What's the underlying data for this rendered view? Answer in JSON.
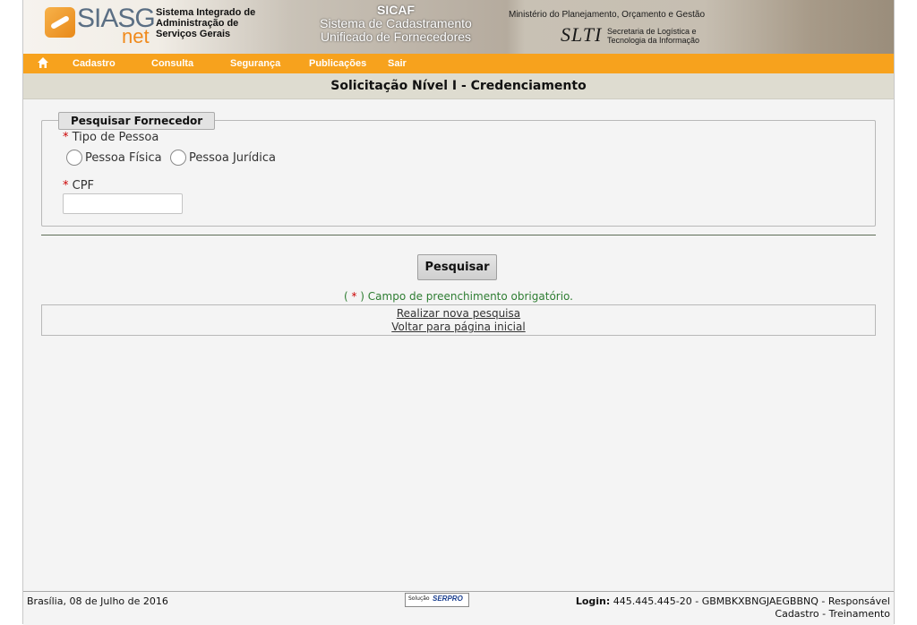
{
  "header": {
    "logo_text": "SIASG",
    "logo_sub": "net",
    "system_line1": "Sistema Integrado de",
    "system_line2": "Administração de",
    "system_line3": "Serviços Gerais",
    "sicaf_title": "SICAF",
    "sicaf_line1": "Sistema de Cadastramento",
    "sicaf_line2": "Unificado de Fornecedores",
    "ministerio": "Ministério do Planejamento, Orçamento e Gestão",
    "slti": "SLTI",
    "slti_line1": "Secretaria de Logística e",
    "slti_line2": "Tecnologia da Informação"
  },
  "menu": {
    "home_icon": "home-icon",
    "items": [
      "Cadastro",
      "Consulta",
      "Segurança",
      "Publicações",
      "Sair"
    ]
  },
  "page_title": "Solicitação Nível I - Credenciamento",
  "form": {
    "legend": "Pesquisar Fornecedor",
    "required_mark": "*",
    "tipo_label": "Tipo de Pessoa",
    "radio_fisica": "Pessoa Física",
    "radio_juridica": "Pessoa Jurídica",
    "cpf_label": "CPF",
    "cpf_value": "",
    "search_button": "Pesquisar",
    "required_note_open": "( ",
    "required_note_close": " ) Campo de preenchimento obrigatório."
  },
  "links": {
    "new_search": "Realizar nova pesquisa",
    "back_home": "Voltar para página inicial"
  },
  "footer": {
    "date": "Brasília, 08 de Julho de 2016",
    "serpro_prefix": "Solução",
    "serpro": "SERPRO",
    "login_label": "Login:",
    "login_value": "445.445.445-20 - GBMBKXBNGJAEGBBNQ - Responsável",
    "login_role": "Cadastro - Treinamento"
  },
  "colors": {
    "menu_bar": "#f7a21d",
    "title_bar": "#dedcd0",
    "required": "#cc0000",
    "note": "#2e7d32"
  }
}
